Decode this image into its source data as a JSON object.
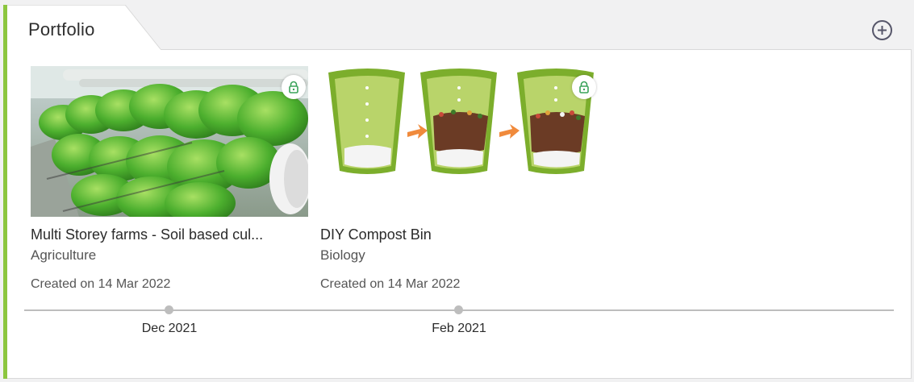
{
  "panel": {
    "title": "Portfolio",
    "add_icon": "plus-circle-icon"
  },
  "items": [
    {
      "title": "Multi Storey farms - Soil based cul...",
      "subject": "Agriculture",
      "created": "Created on 14 Mar 2022",
      "image": "hydroponic-greens-photo",
      "lock_icon": "lock-icon"
    },
    {
      "title": "DIY Compost Bin",
      "subject": "Biology",
      "created": "Created on 14 Mar 2022",
      "image": "compost-bin-diagram",
      "lock_icon": "lock-icon"
    }
  ],
  "timeline": {
    "labels": [
      "Dec 2021",
      "Feb 2021"
    ]
  },
  "colors": {
    "accent": "#8cc63f",
    "lock": "#3aa35a"
  }
}
